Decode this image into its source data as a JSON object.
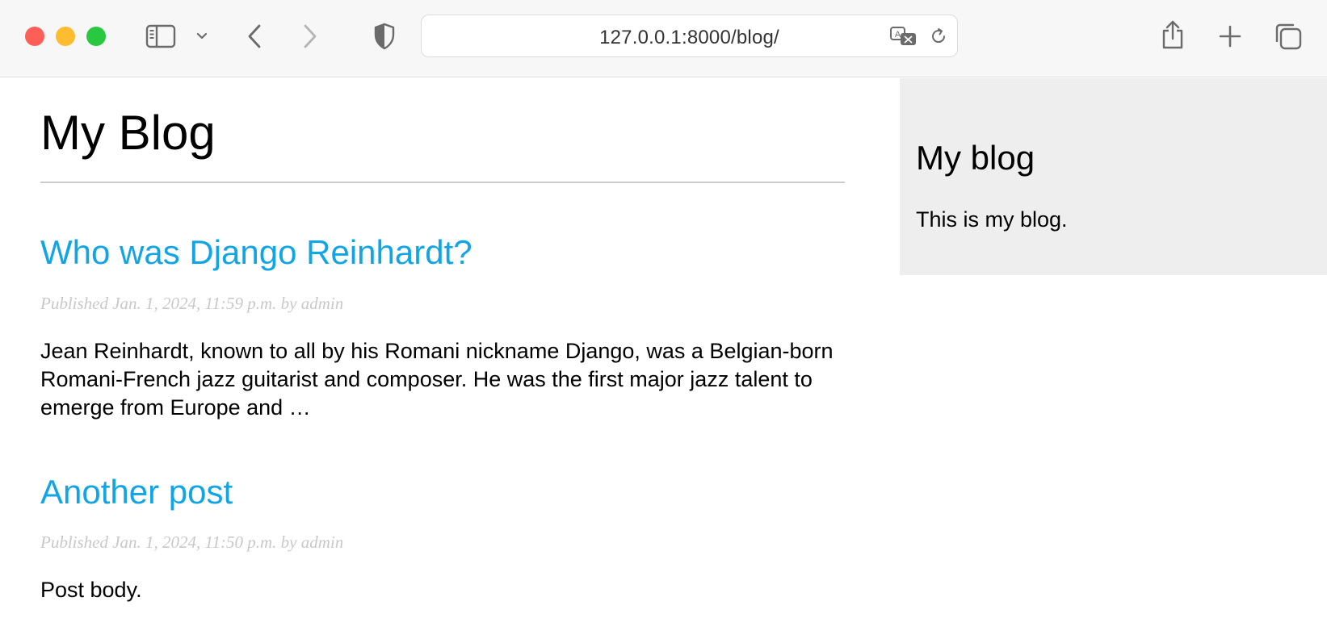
{
  "browser": {
    "url": "127.0.0.1:8000/blog/",
    "icons": {
      "sidebar_toggle": "sidebar-icon",
      "sidebar_menu": "chevron-down-icon",
      "back": "back-arrow-icon",
      "forward": "forward-arrow-icon",
      "privacy": "shield-icon",
      "translate": "translate-icon",
      "reload": "reload-icon",
      "share": "share-icon",
      "new_tab": "plus-icon",
      "tab_overview": "tabs-icon"
    },
    "colors": {
      "close": "#ff5f57",
      "minimize": "#febc2e",
      "zoom": "#28c840"
    }
  },
  "page": {
    "site_title": "My Blog",
    "link_color": "#12a5e6",
    "posts": [
      {
        "title": "Who was Django Reinhardt?",
        "meta": "Published Jan. 1, 2024, 11:59 p.m. by admin",
        "body": "Jean Reinhardt, known to all by his Romani nickname Django, was a Belgian-born Romani-French jazz guitarist and composer. He was the first major jazz talent to emerge from Europe and …"
      },
      {
        "title": "Another post",
        "meta": "Published Jan. 1, 2024, 11:50 p.m. by admin",
        "body": "Post body."
      }
    ]
  },
  "sidebar": {
    "title": "My blog",
    "text": "This is my blog."
  }
}
